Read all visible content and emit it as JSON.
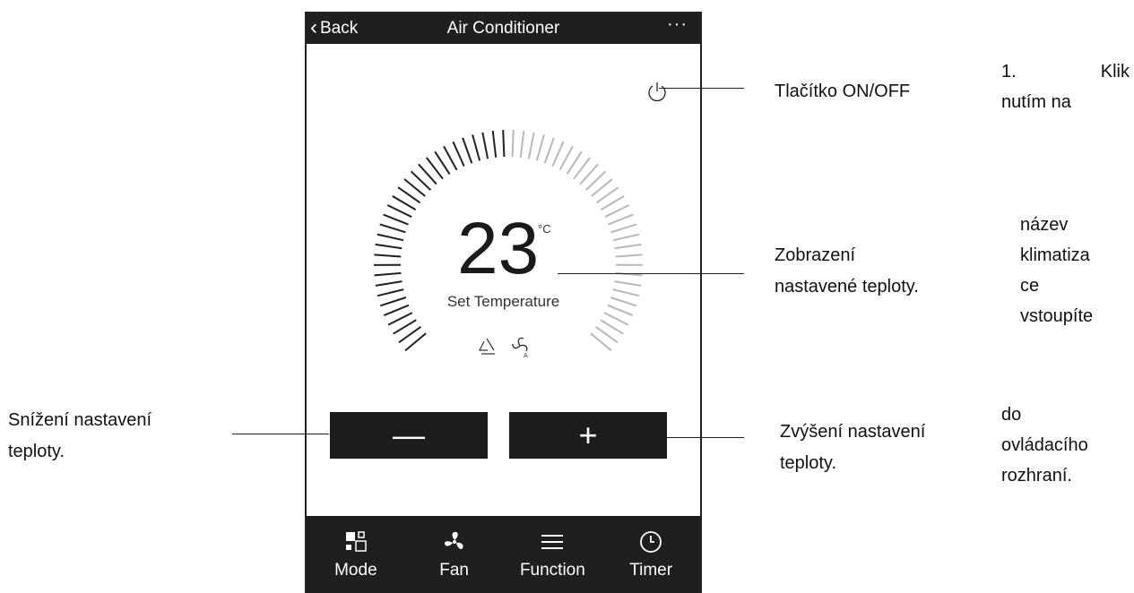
{
  "app": {
    "back_label": "Back",
    "title": "Air Conditioner",
    "more_label": "···"
  },
  "display": {
    "temperature": "23",
    "unit": "°C",
    "label": "Set Temperature"
  },
  "controls": {
    "minus_label": "—",
    "plus_label": "+"
  },
  "bottom_tabs": [
    {
      "label": "Mode",
      "icon": "mode-icon"
    },
    {
      "label": "Fan",
      "icon": "fan-icon"
    },
    {
      "label": "Function",
      "icon": "menu-icon"
    },
    {
      "label": "Timer",
      "icon": "clock-icon"
    }
  ],
  "annotations": {
    "power": "Tlačítko ON/OFF",
    "display_line1": "Zobrazení",
    "display_line2": "nastavené teploty.",
    "decrease_line1": "Snížení nastavení",
    "decrease_line2": "teploty.",
    "increase_line1": "Zvýšení nastavení",
    "increase_line2": "teploty."
  },
  "side_text": {
    "line1a": "1.",
    "line1b": "Klik",
    "lines": [
      "nutím na",
      "",
      "",
      "název",
      "klimatiza",
      "ce",
      "vstoupíte",
      "",
      "do",
      "ovládacího",
      "rozhraní."
    ]
  },
  "colors": {
    "bar": "#1f1f1f",
    "button": "#1c1c1c",
    "tick_dark": "#222222",
    "tick_light": "#b8b8b8"
  }
}
